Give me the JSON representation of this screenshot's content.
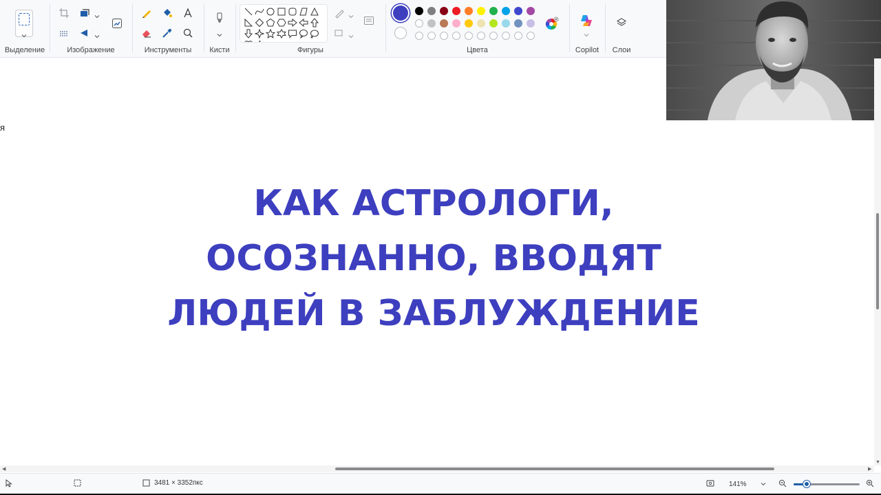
{
  "ribbon": {
    "groups": {
      "selection": "Выделение",
      "image": "Изображение",
      "tools": "Инструменты",
      "brushes": "Кисти",
      "shapes": "Фигуры",
      "colors": "Цвета",
      "copilot": "Copilot",
      "layers": "Слои"
    },
    "active_color": "#3d3fbf",
    "secondary_color": "#ffffff",
    "palette_row1": [
      "#000000",
      "#7f7f7f",
      "#880015",
      "#ed1c24",
      "#ff7f27",
      "#fff200",
      "#22b14c",
      "#00a2e8",
      "#3f48cc",
      "#a349a4"
    ],
    "palette_row2": [
      "#ffffff",
      "#c3c3c3",
      "#b97a57",
      "#ffaec9",
      "#ffc90e",
      "#efe4b0",
      "#b5e61d",
      "#99d9ea",
      "#7092be",
      "#c8bfe7"
    ],
    "palette_row3_empty_count": 10
  },
  "canvas": {
    "stray_text": "я",
    "headline": [
      "КАК АСТРОЛОГИ,",
      "ОСОЗНАННО, ВВОДЯТ",
      "ЛЮДЕЙ В ЗАБЛУЖДЕНИЕ"
    ],
    "headline_color": "#3d3fbf"
  },
  "statusbar": {
    "canvas_size": "3481 × 3352пкс",
    "zoom": "141%",
    "zoom_fraction": 0.2
  }
}
